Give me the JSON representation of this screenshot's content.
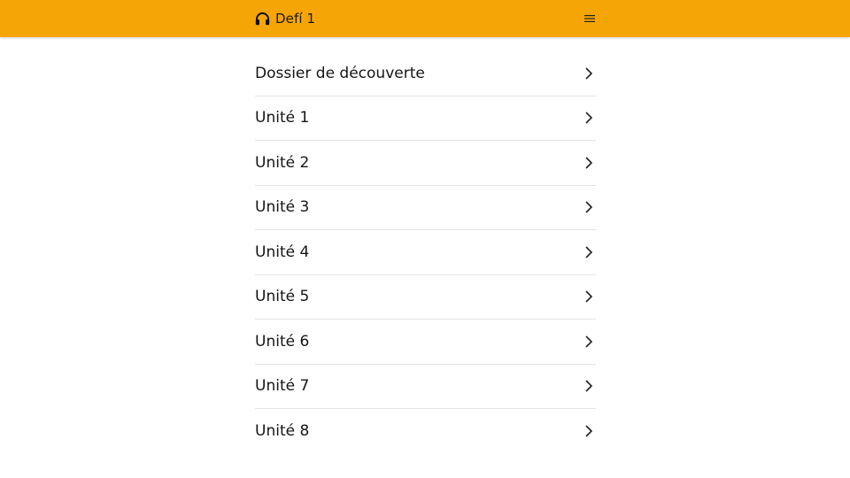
{
  "header": {
    "title": "Defí 1",
    "brand_icon": "headphones-icon",
    "menu_icon": "hamburger-menu-icon",
    "background_color": "#f5a505"
  },
  "list": {
    "items": [
      {
        "label": "Dossier de découverte",
        "icon": "chevron-right-icon"
      },
      {
        "label": "Unité 1",
        "icon": "chevron-right-icon"
      },
      {
        "label": "Unité 2",
        "icon": "chevron-right-icon"
      },
      {
        "label": "Unité 3",
        "icon": "chevron-right-icon"
      },
      {
        "label": "Unité 4",
        "icon": "chevron-right-icon"
      },
      {
        "label": "Unité 5",
        "icon": "chevron-right-icon"
      },
      {
        "label": "Unité 6",
        "icon": "chevron-right-icon"
      },
      {
        "label": "Unité 7",
        "icon": "chevron-right-icon"
      },
      {
        "label": "Unité 8",
        "icon": "chevron-right-icon"
      }
    ]
  }
}
